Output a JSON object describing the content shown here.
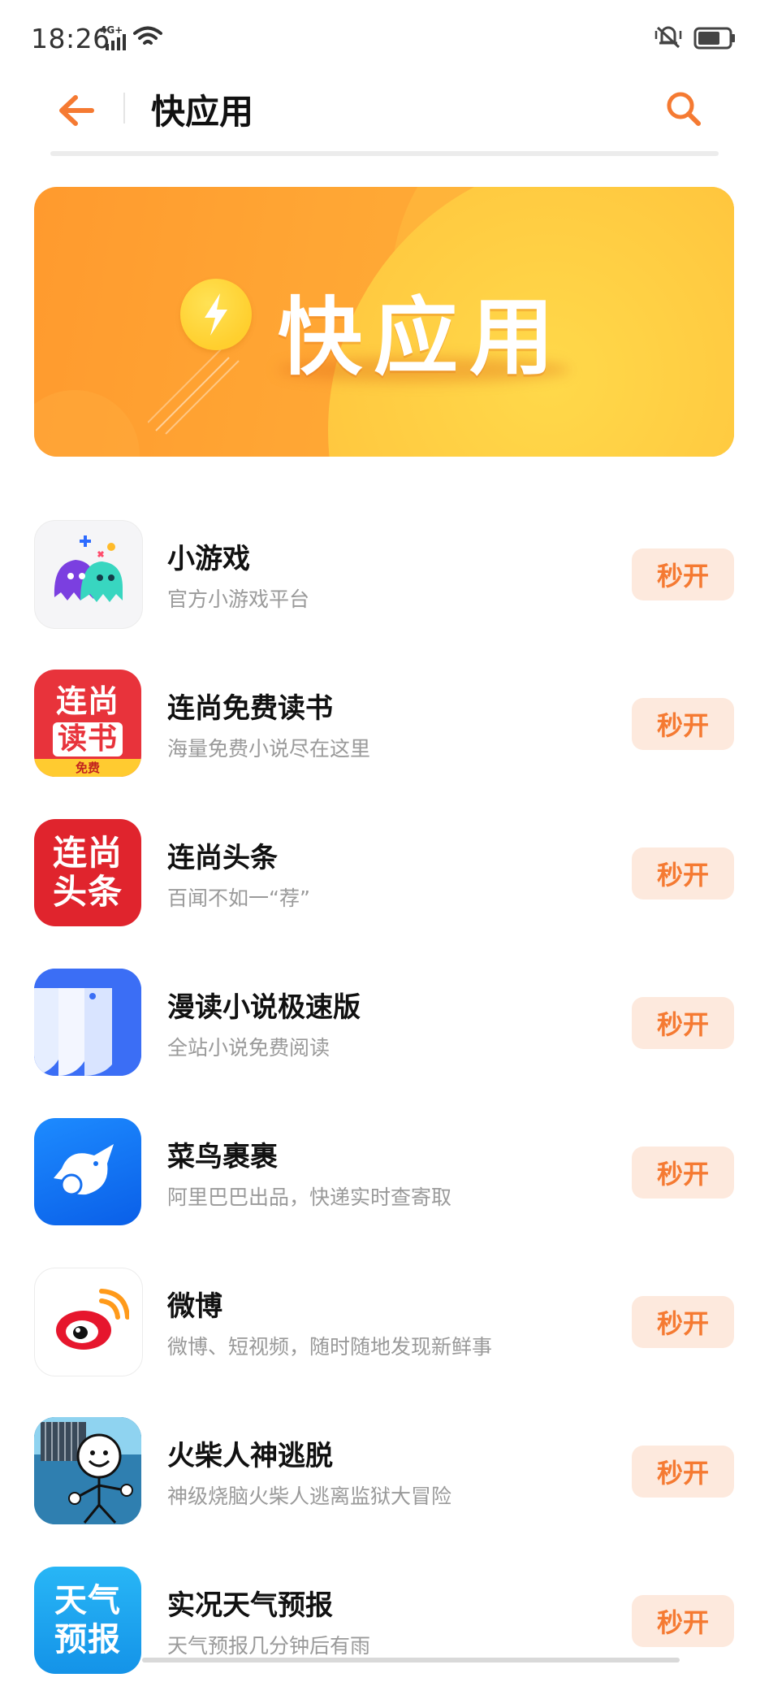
{
  "status_bar": {
    "time": "18:26",
    "network": "4G+"
  },
  "header": {
    "title": "快应用"
  },
  "banner": {
    "title": "快应用"
  },
  "apps": [
    {
      "name": "小游戏",
      "desc": "官方小游戏平台",
      "button": "秒开"
    },
    {
      "name": "连尚免费读书",
      "desc": "海量免费小说尽在这里",
      "button": "秒开",
      "icon_text": [
        "连尚",
        "读书"
      ],
      "icon_badge": "免费"
    },
    {
      "name": "连尚头条",
      "desc": "百闻不如一“荐”",
      "button": "秒开",
      "icon_text": [
        "连尚",
        "头条"
      ]
    },
    {
      "name": "漫读小说极速版",
      "desc": "全站小说免费阅读",
      "button": "秒开"
    },
    {
      "name": "菜鸟裹裹",
      "desc": "阿里巴巴出品，快递实时查寄取",
      "button": "秒开"
    },
    {
      "name": "微博",
      "desc": "微博、短视频，随时随地发现新鲜事",
      "button": "秒开"
    },
    {
      "name": "火柴人神逃脱",
      "desc": "神级烧脑火柴人逃离监狱大冒险",
      "button": "秒开"
    },
    {
      "name": "实况天气预报",
      "desc": "天气预报几分钟后有雨",
      "button": "秒开",
      "icon_text": [
        "天气",
        "预报"
      ]
    }
  ],
  "colors": {
    "accent": "#f57a32",
    "button_bg": "#fde9dd",
    "banner": "#ffa634"
  },
  "icons": [
    "back-arrow-icon",
    "search-icon",
    "signal-icon",
    "wifi-icon",
    "vibrate-icon",
    "battery-icon",
    "lightning-icon"
  ]
}
